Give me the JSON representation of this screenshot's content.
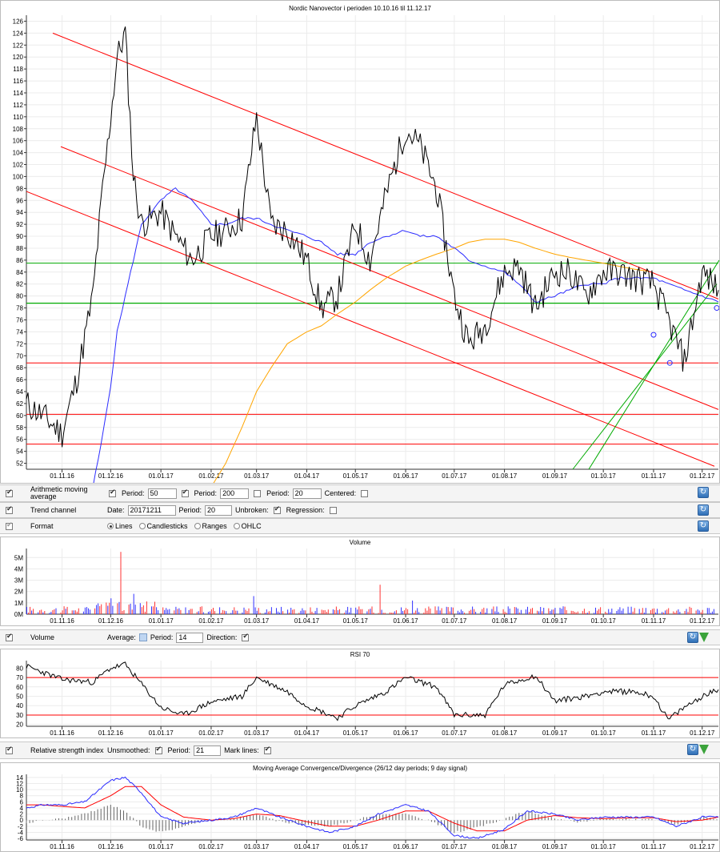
{
  "price_chart": {
    "title": "Nordic Nanovector i perioden 10.10.16 til 11.12.17",
    "y_ticks": [
      52,
      54,
      56,
      58,
      60,
      62,
      64,
      66,
      68,
      70,
      72,
      74,
      76,
      78,
      80,
      82,
      84,
      86,
      88,
      90,
      92,
      94,
      96,
      98,
      100,
      102,
      104,
      106,
      108,
      110,
      112,
      114,
      116,
      118,
      120,
      122,
      124,
      126
    ],
    "x_ticks": [
      "01.11.16",
      "01.12.16",
      "01.01.17",
      "01.02.17",
      "01.03.17",
      "01.04.17",
      "01.05.17",
      "01.06.17",
      "01.07.17",
      "01.08.17",
      "01.09.17",
      "01.10.17",
      "01.11.17",
      "01.12.17"
    ]
  },
  "controls": {
    "ma": {
      "label": "Arithmetic moving average",
      "period_label": "Period:",
      "p1": "50",
      "p2": "200",
      "p3": "20",
      "centered_label": "Centered:"
    },
    "trend": {
      "label": "Trend channel",
      "date_label": "Date:",
      "date": "20171211",
      "period_label": "Period:",
      "period": "20",
      "unbroken_label": "Unbroken:",
      "regression_label": "Regression:"
    },
    "format": {
      "label": "Format",
      "options": [
        "Lines",
        "Candlesticks",
        "Ranges",
        "OHLC"
      ]
    }
  },
  "volume_chart": {
    "title": "Volume",
    "y_ticks": [
      "0M",
      "1M",
      "2M",
      "3M",
      "4M",
      "5M"
    ],
    "control": {
      "label": "Volume",
      "average_label": "Average:",
      "period_label": "Period:",
      "period": "14",
      "direction_label": "Direction:"
    }
  },
  "rsi_chart": {
    "title": "RSI 70",
    "y_ticks": [
      "20",
      "30",
      "40",
      "50",
      "60",
      "70",
      "80"
    ],
    "control": {
      "label": "Relative strength index",
      "unsmoothed_label": "Unsmoothed:",
      "period_label": "Period:",
      "period": "21",
      "mark_label": "Mark lines:"
    }
  },
  "macd_chart": {
    "title": "Moving Average Convergence/Divergence (26/12 day periods; 9 day signal)",
    "y_ticks": [
      "-6",
      "-4",
      "-2",
      "0",
      "2",
      "4",
      "6",
      "8",
      "10",
      "12",
      "14"
    ]
  },
  "colors": {
    "price": "#000000",
    "ma50": "#2b2bff",
    "ma200": "#ffa500",
    "trend": "#ff0000",
    "support": "#00aa00",
    "vol_up": "#3333ff",
    "vol_down": "#ff3333"
  },
  "chart_data": [
    {
      "type": "line",
      "title": "Nordic Nanovector i perioden 10.10.16 til 11.12.17",
      "x": [
        "10.10.16",
        "20.10.16",
        "01.11.16",
        "10.11.16",
        "20.11.16",
        "25.11.16",
        "01.12.16",
        "05.12.16",
        "10.12.16",
        "15.12.16",
        "20.12.16",
        "01.01.17",
        "10.01.17",
        "20.01.17",
        "01.02.17",
        "10.02.17",
        "20.02.17",
        "01.03.17",
        "10.03.17",
        "20.03.17",
        "01.04.17",
        "10.04.17",
        "20.04.17",
        "01.05.17",
        "10.05.17",
        "20.05.17",
        "01.06.17",
        "10.06.17",
        "20.06.17",
        "01.07.17",
        "10.07.17",
        "20.07.17",
        "01.08.17",
        "10.08.17",
        "20.08.17",
        "01.09.17",
        "10.09.17",
        "20.09.17",
        "01.10.17",
        "10.10.17",
        "20.10.17",
        "01.11.17",
        "10.11.17",
        "20.11.17",
        "01.12.17",
        "11.12.17"
      ],
      "series": [
        {
          "name": "Close",
          "values": [
            62,
            60,
            57,
            66,
            80,
            95,
            110,
            120,
            124,
            100,
            92,
            94,
            90,
            86,
            90,
            91,
            93,
            110,
            92,
            91,
            86,
            78,
            80,
            92,
            86,
            97,
            108,
            105,
            98,
            80,
            72,
            75,
            84,
            85,
            78,
            84,
            84,
            80,
            84,
            84,
            83,
            82,
            76,
            69,
            84,
            81
          ]
        },
        {
          "values": [
            null,
            null,
            null,
            null,
            48,
            55,
            65,
            74,
            80,
            86,
            92,
            96,
            98,
            96,
            92,
            92,
            93,
            93,
            92,
            91,
            90,
            89,
            87,
            87,
            89,
            90,
            91,
            90,
            90,
            88,
            86,
            85,
            84,
            82,
            79,
            80,
            81,
            82,
            82,
            83,
            83,
            83,
            82,
            81,
            80,
            79
          ]
        },
        {
          "values": [
            null,
            null,
            null,
            null,
            null,
            null,
            null,
            null,
            null,
            null,
            null,
            null,
            null,
            null,
            48,
            52,
            58,
            64,
            68,
            72,
            74,
            75,
            77,
            79,
            81,
            83,
            85,
            86,
            87,
            88,
            89,
            89.5,
            89.5,
            89,
            88,
            87,
            86.5,
            86,
            85.5,
            85,
            84.5,
            84
          ]
        }
      ],
      "ylim": [
        51,
        127
      ],
      "horizontal_lines": [
        85.5,
        78.8,
        68.8,
        60.2,
        55.2
      ]
    },
    {
      "type": "bar",
      "title": "Volume",
      "ylim": [
        0,
        5.8
      ]
    },
    {
      "type": "line",
      "title": "RSI 70",
      "x": [
        "10.10.16",
        "01.11.16",
        "20.11.16",
        "01.12.16",
        "10.12.16",
        "01.01.17",
        "15.01.17",
        "01.02.17",
        "20.02.17",
        "01.03.17",
        "20.03.17",
        "01.04.17",
        "20.04.17",
        "01.05.17",
        "20.05.17",
        "01.06.17",
        "20.06.17",
        "01.07.17",
        "20.07.17",
        "01.08.17",
        "20.08.17",
        "01.09.17",
        "20.09.17",
        "01.10.17",
        "20.10.17",
        "01.11.17",
        "10.11.17",
        "20.11.17",
        "01.12.17",
        "11.12.17"
      ],
      "values": [
        82,
        68,
        65,
        80,
        84,
        38,
        30,
        44,
        50,
        70,
        55,
        40,
        27,
        40,
        55,
        70,
        60,
        30,
        30,
        62,
        72,
        45,
        50,
        55,
        55,
        50,
        25,
        38,
        50,
        57
      ],
      "ylim": [
        18,
        88
      ],
      "mark_lines": [
        30,
        70
      ]
    },
    {
      "type": "line",
      "title": "Moving Average Convergence/Divergence (26/12 day periods; 9 day signal)",
      "x": [
        "10.10.16",
        "20.10.16",
        "01.11.16",
        "15.11.16",
        "01.12.16",
        "10.12.16",
        "20.12.16",
        "01.01.17",
        "15.01.17",
        "01.02.17",
        "15.02.17",
        "01.03.17",
        "15.03.17",
        "01.04.17",
        "15.04.17",
        "01.05.17",
        "15.05.17",
        "01.06.17",
        "15.06.17",
        "01.07.17",
        "15.07.17",
        "01.08.17",
        "15.08.17",
        "01.09.17",
        "15.09.17",
        "01.10.17",
        "15.10.17",
        "01.11.17",
        "15.11.17",
        "01.12.17",
        "11.12.17"
      ],
      "series": [
        {
          "name": "MACD",
          "values": [
            4,
            5,
            5,
            6,
            13,
            14,
            9,
            1,
            -1,
            0,
            1,
            4,
            1,
            -2,
            -4,
            -2,
            2,
            5,
            3,
            -5,
            -6,
            -3,
            3,
            2,
            0,
            1,
            1,
            1,
            -2,
            1,
            1
          ]
        },
        {
          "name": "Signal",
          "values": [
            5,
            5,
            4.5,
            4,
            8,
            11,
            11,
            5,
            1,
            0,
            0.5,
            2,
            1.5,
            -0.5,
            -2,
            -2,
            0,
            3,
            3,
            -1,
            -3.5,
            -3.5,
            0,
            1.5,
            0.8,
            0.5,
            0.7,
            0.8,
            -0.5,
            0,
            1
          ]
        }
      ],
      "ylim": [
        -6.5,
        15
      ]
    }
  ]
}
